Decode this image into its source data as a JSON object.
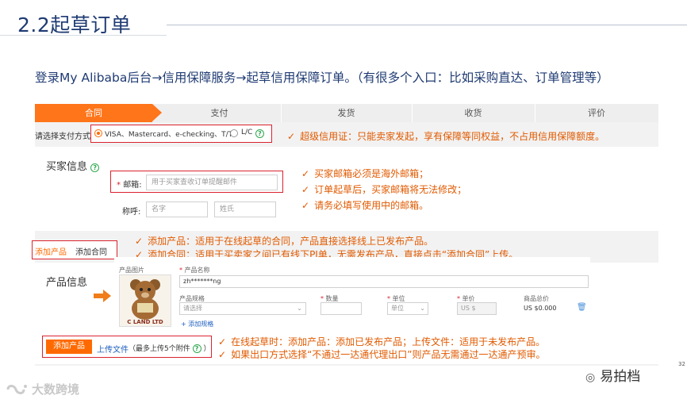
{
  "slide": {
    "title": "2.2起草订单",
    "subtitle": "登录My Alibaba后台→信用保障服务→起草信用保障订单。（有很多个入口：比如采购直达、订单管理等）",
    "page_number": "32"
  },
  "steps": [
    "合同",
    "支付",
    "发货",
    "收货",
    "评价"
  ],
  "payment": {
    "label": "请选择支付方式：",
    "option_cards": "VISA、Mastercard、e-checking、T/T",
    "option_lc": "L/C",
    "note": "超级信用证：只能卖家发起，享有保障等同权益，不占用信用保障额度。"
  },
  "buyer": {
    "title": "买家信息",
    "email_label": "邮箱",
    "email_placeholder": "用于买家查收订单提醒邮件",
    "name_label": "称呼",
    "first_placeholder": "名字",
    "last_placeholder": "姓氏",
    "notes": [
      "买家邮箱必须是海外邮箱；",
      "订单起草后，买家邮箱将无法修改；",
      "请务必填写使用中的邮箱。"
    ]
  },
  "tabs": {
    "add_product": "添加产品",
    "add_contract": "添加合同",
    "notes": [
      "添加产品：适用于在线起草的合同，产品直接选择线上已发布产品。",
      "添加合同：适用于买卖家之间已有线下PI单，无需发布产品，直接点击“添加合同”上传。"
    ]
  },
  "product": {
    "section_title": "产品信息",
    "image_label": "产品图片",
    "image_caption": "C LAND LTD",
    "name_label": "产品名称",
    "name_value": "zh*******ng",
    "spec_label": "产品规格",
    "spec_placeholder": "请选择",
    "qty_label": "数量",
    "unit_label": "单位",
    "unit_placeholder": "单位",
    "price_label": "单价",
    "price_placeholder": "US $",
    "total_label": "商品总价",
    "total_value": "US $0.000",
    "add_spec": "+ 添加规格",
    "add_button": "添加产品",
    "upload_link": "上传文件",
    "upload_hint": "（最多上传5个附件",
    "upload_hint_end": "）",
    "notes": [
      "在线起草时：添加产品：添加已发布产品；上传文件：适用于未发布产品。",
      "如果出口方式选择“不通过一达通代理出口”则产品无需通过一达通产预审。"
    ]
  },
  "watermarks": {
    "brand_right": "易拍档",
    "brand_left": "大数跨境"
  },
  "colors": {
    "accent": "#ff6a00",
    "title": "#1f3b73",
    "highlight": "#d9232e",
    "note": "#e15a00"
  }
}
